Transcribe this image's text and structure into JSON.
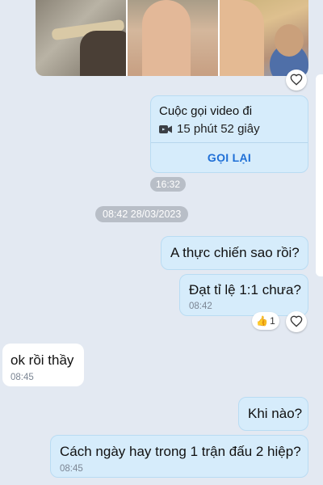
{
  "call_card": {
    "title": "Cuộc gọi video đi",
    "duration": "15 phút 52 giây",
    "button_label": "GỌI LẠI",
    "time": "16:32"
  },
  "date_divider": "08:42 28/03/2023",
  "messages": [
    {
      "direction": "out",
      "text": "A thực chiến sao rồi?",
      "time": ""
    },
    {
      "direction": "out",
      "text": "Đạt tỉ lệ 1:1 chưa?",
      "time": "08:42",
      "reaction": {
        "emoji": "👍",
        "count": "1"
      }
    },
    {
      "direction": "in",
      "text": "ok rồi thầy",
      "time": "08:45"
    },
    {
      "direction": "out",
      "text": "Khi nào?",
      "time": ""
    },
    {
      "direction": "out",
      "text": "Cách ngày hay trong 1 trận đấu 2 hiệp?",
      "time": "08:45"
    }
  ],
  "icons": {
    "heart": "heart-icon",
    "video": "video-camera-icon",
    "thumbs_up": "thumbs-up-icon"
  },
  "colors": {
    "background": "#e3e9f2",
    "outgoing_bubble": "#d6ecfb",
    "incoming_bubble": "#ffffff",
    "accent": "#1f6fd6"
  }
}
